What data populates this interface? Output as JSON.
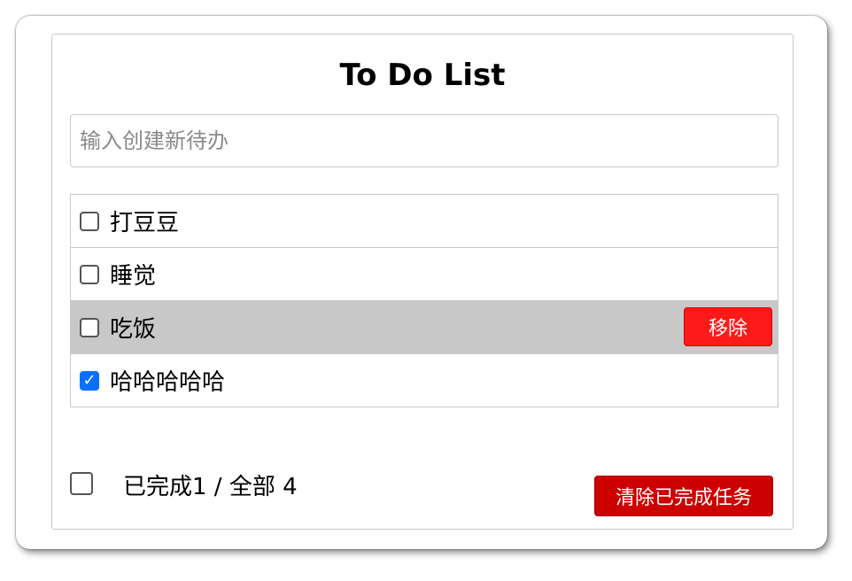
{
  "app": {
    "title": "To Do List"
  },
  "new_todo": {
    "placeholder": "输入创建新待办",
    "value": ""
  },
  "todos": [
    {
      "label": "打豆豆",
      "done": false
    },
    {
      "label": "睡觉",
      "done": false
    },
    {
      "label": "吃饭",
      "done": false,
      "hovered": true
    },
    {
      "label": "哈哈哈哈哈",
      "done": true
    }
  ],
  "item_actions": {
    "remove_label": "移除"
  },
  "footer": {
    "select_all_checked": false,
    "done_text": "已完成",
    "done_count": "1",
    "separator": " / ",
    "total_text": "全部",
    "total_count": "4",
    "stats": "已完成1 / 全部 4",
    "clear_label": "清除已完成任务"
  },
  "colors": {
    "remove_button": "#ff1a1a",
    "clear_button": "#cc0000",
    "hover_row": "#c8c8c8",
    "checkbox_checked": "#0b6ffd"
  }
}
